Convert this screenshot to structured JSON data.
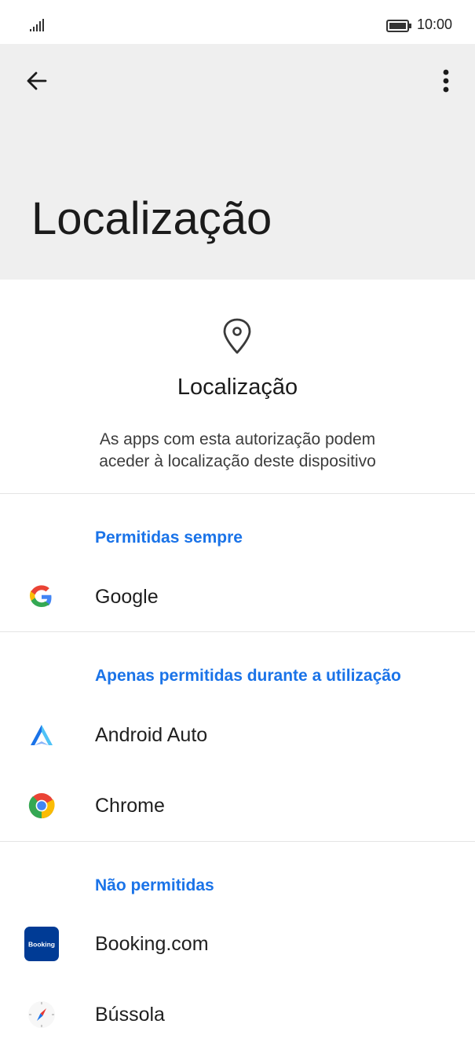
{
  "status_bar": {
    "time": "10:00"
  },
  "app_bar": {
    "title": "Localização"
  },
  "permission_header": {
    "title": "Localização",
    "description_line1": "As apps com esta autorização podem",
    "description_line2": "aceder à localização deste dispositivo"
  },
  "sections": {
    "always": {
      "title": "Permitidas sempre"
    },
    "while_using": {
      "title": "Apenas permitidas durante a utilização"
    },
    "denied": {
      "title": "Não permitidas"
    }
  },
  "apps": {
    "google": {
      "label": "Google",
      "icon": "google-icon"
    },
    "android_auto": {
      "label": "Android Auto",
      "icon": "android-auto-icon"
    },
    "chrome": {
      "label": "Chrome",
      "icon": "chrome-icon"
    },
    "booking": {
      "label": "Booking.com",
      "icon": "booking-icon",
      "icon_text": "Booking"
    },
    "compass": {
      "label": "Bússola",
      "icon": "compass-icon"
    }
  },
  "colors": {
    "accent": "#1a73e8",
    "app_bar_bg": "#efefef"
  }
}
